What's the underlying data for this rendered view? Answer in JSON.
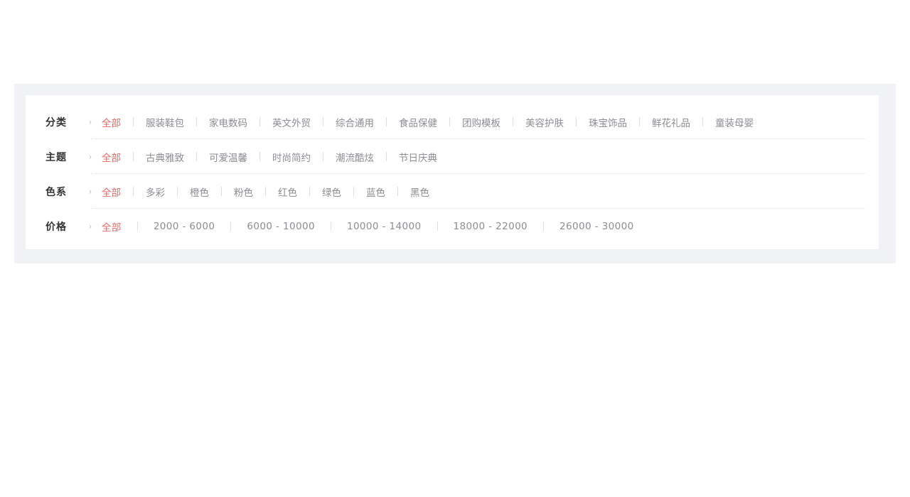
{
  "theme": {
    "accent_color": "#e06a62",
    "option_color": "#8d8d93",
    "label_color": "#333333",
    "shell_bg": "#f1f2f6",
    "card_bg": "#ffffff",
    "separator_color": "#dedee2",
    "divider_color": "#e3e3e6"
  },
  "filter": {
    "chevron_glyph": "›",
    "rows": [
      {
        "label": "分类",
        "options": [
          "全部",
          "服装鞋包",
          "家电数码",
          "英文外贸",
          "综合通用",
          "食品保健",
          "团购模板",
          "美容护肤",
          "珠宝饰品",
          "鲜花礼品",
          "童装母婴"
        ],
        "active_index": 0
      },
      {
        "label": "主题",
        "options": [
          "全部",
          "古典雅致",
          "可爱温馨",
          "时尚简约",
          "潮流酷炫",
          "节日庆典"
        ],
        "active_index": 0
      },
      {
        "label": "色系",
        "options": [
          "全部",
          "多彩",
          "橙色",
          "粉色",
          "红色",
          "绿色",
          "蓝色",
          "黑色"
        ],
        "active_index": 0
      },
      {
        "label": "价格",
        "options": [
          "全部",
          "2000 - 6000",
          "6000 - 10000",
          "10000 - 14000",
          "18000 - 22000",
          "26000 - 30000"
        ],
        "active_index": 0
      }
    ]
  }
}
